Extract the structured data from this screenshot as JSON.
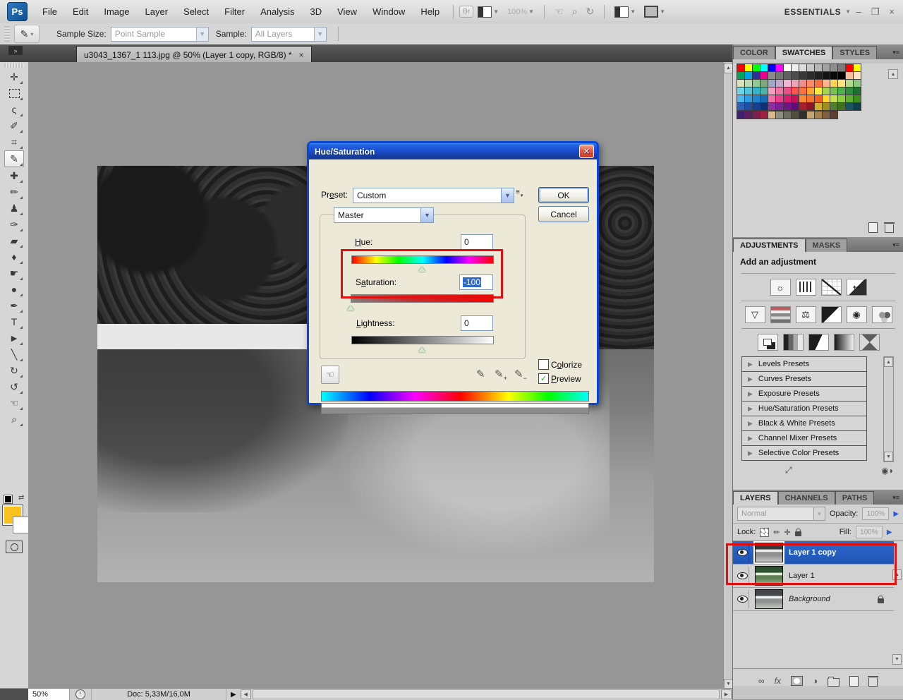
{
  "app": {
    "logo": "Ps",
    "menu": [
      "File",
      "Edit",
      "Image",
      "Layer",
      "Select",
      "Filter",
      "Analysis",
      "3D",
      "View",
      "Window",
      "Help"
    ],
    "br_label": "Br",
    "zoom_indicator": "100%",
    "workspace": "ESSENTIALS"
  },
  "icons": {
    "dropdown": "▼",
    "small_dd": "▾",
    "menu_lines": "≡",
    "min": "–",
    "restore": "❐",
    "win_close": "×",
    "up": "▲",
    "down": "▼",
    "left": "◀",
    "right": "▶",
    "flyout": "▶",
    "collapse": "»",
    "hand": "☜",
    "zoom_tool": "⌕",
    "rotate": "↻",
    "eyedropper": "✎",
    "check": "✓",
    "close": "✕",
    "plus": "+",
    "minus": "−",
    "sun": "☼",
    "vibrance": "▽",
    "scale": "⚖",
    "lens": "◉",
    "half_circle": "◑",
    "link": "∞",
    "fx": "fx",
    "expand": "⤢",
    "panel_eye": "◉◗"
  },
  "options_bar": {
    "sample_size_label": "Sample Size:",
    "sample_size_value": "Point Sample",
    "sample_label": "Sample:",
    "sample_value": "All Layers"
  },
  "document": {
    "tab_title": "u3043_1367_1 113.jpg @ 50% (Layer 1 copy, RGB/8) *",
    "status_zoom": "50%",
    "doc_size": "Doc: 5,33M/16,0M"
  },
  "tools": [
    {
      "name": "move-tool",
      "glyph": "✛"
    },
    {
      "name": "rectangular-marquee-tool",
      "cls": "g-marquee"
    },
    {
      "name": "lasso-tool",
      "glyph": "ς"
    },
    {
      "name": "quick-selection-tool",
      "glyph": "✐"
    },
    {
      "name": "crop-tool",
      "glyph": "⌗"
    },
    {
      "name": "eyedropper-tool",
      "glyph": "✎",
      "selected": true
    },
    {
      "name": "spot-healing-brush-tool",
      "glyph": "✚"
    },
    {
      "name": "brush-tool",
      "glyph": "✏"
    },
    {
      "name": "clone-stamp-tool",
      "glyph": "♟"
    },
    {
      "name": "history-brush-tool",
      "glyph": "✑"
    },
    {
      "name": "eraser-tool",
      "glyph": "▰"
    },
    {
      "name": "paint-bucket-tool",
      "glyph": "♦"
    },
    {
      "name": "smudge-tool",
      "glyph": "☛"
    },
    {
      "name": "burn-tool",
      "glyph": "●"
    },
    {
      "name": "pen-tool",
      "glyph": "✒"
    },
    {
      "name": "type-tool",
      "glyph": "T"
    },
    {
      "name": "path-selection-tool",
      "glyph": "►"
    },
    {
      "name": "line-tool",
      "glyph": "╲"
    },
    {
      "name": "3d-rotate-tool",
      "glyph": "↻"
    },
    {
      "name": "3d-orbit-tool",
      "glyph": "↺"
    },
    {
      "name": "hand-tool",
      "glyph": "☜"
    },
    {
      "name": "zoom-tool",
      "glyph": "⌕"
    }
  ],
  "toolbar_colors": {
    "foreground": "#F7C11E",
    "background": "#FFFFFF"
  },
  "dialog": {
    "title": "Hue/Saturation",
    "labels": {
      "preset": {
        "pre": "Pr",
        "key": "e",
        "post": "set:"
      },
      "hue": {
        "pre": "",
        "key": "H",
        "post": "ue:"
      },
      "saturation": {
        "pre": "S",
        "key": "a",
        "post": "turation:"
      },
      "lightness": {
        "pre": "",
        "key": "L",
        "post": "ightness:"
      },
      "colorize": {
        "pre": "C",
        "key": "o",
        "post": "lorize"
      },
      "preview": {
        "pre": "",
        "key": "P",
        "post": "review"
      }
    },
    "preset_value": "Custom",
    "channel_value": "Master",
    "hue_value": "0",
    "saturation_value": "-100",
    "lightness_value": "0",
    "ok": "OK",
    "cancel": "Cancel",
    "preview_checked": true,
    "colorize_checked": false
  },
  "panels": {
    "color_panel": {
      "tabs": [
        "COLOR",
        "SWATCHES",
        "STYLES"
      ],
      "active": 1
    },
    "swatches": {
      "colors": [
        "#FF0000",
        "#FFFF00",
        "#00FF00",
        "#00FFFF",
        "#0000FF",
        "#FF00FF",
        "#FFFFFF",
        "#EDEDED",
        "#DBDBDB",
        "#C8C8C8",
        "#B5B5B5",
        "#A1A1A1",
        "#8E8E8E",
        "#7A7A7A",
        "#FF0000",
        "#FFFF00",
        "#00A45A",
        "#00A0E4",
        "#2E3192",
        "#EC008C",
        "#8A8A8A",
        "#757575",
        "#616161",
        "#4D4D4D",
        "#383838",
        "#2B2B2B",
        "#1F1F1F",
        "#141414",
        "#0A0A0A",
        "#000000",
        "#F7BE9E",
        "#FCE2BF",
        "#D9E2B8",
        "#BBDCB3",
        "#93C993",
        "#7FA87F",
        "#9FA8C4",
        "#C3A8C9",
        "#F0B6D2",
        "#EFA3B7",
        "#F08C8C",
        "#FF8A66",
        "#FF6E43",
        "#FFB28C",
        "#FFD34F",
        "#FFE37F",
        "#B5D98A",
        "#8CC97F",
        "#6FD6E8",
        "#4FC6DC",
        "#2FB5CE",
        "#4FB3A5",
        "#F49FC0",
        "#F075A5",
        "#EC4F8A",
        "#FF5252",
        "#FF7043",
        "#FFA733",
        "#FFE93B",
        "#A6D64F",
        "#76C24F",
        "#4FAF4F",
        "#2F8F3F",
        "#1F6F2F",
        "#4FB6F0",
        "#2F9BE0",
        "#1F85D0",
        "#1670B8",
        "#F06FA5",
        "#EC3F8A",
        "#D81F6F",
        "#C21458",
        "#FB8C2F",
        "#F5742F",
        "#EF5F1F",
        "#FFD52F",
        "#C5E04F",
        "#8FCF3F",
        "#5FAF2F",
        "#3F8F1F",
        "#2F5FB5",
        "#1F4FA5",
        "#16408F",
        "#0F3075",
        "#8F2FA5",
        "#7F1F95",
        "#6F1585",
        "#5F0F75",
        "#A51F2F",
        "#8F1525",
        "#CFAF2F",
        "#9F8F1F",
        "#4F7F2F",
        "#3F6F1F",
        "#16555F",
        "#0F3F4F"
      ],
      "colors_tail": [
        "#3F1F6F",
        "#5F1F5F",
        "#7F1F4F",
        "#9F1F3F",
        "#D9B88C",
        "#8F8F7F",
        "#6F6F5F",
        "#4F4F3F",
        "#2F2F2F",
        "#C9A66F",
        "#A5804F",
        "#7F5F3F",
        "#5F3F2F"
      ]
    },
    "adjustments": {
      "tabs": [
        "ADJUSTMENTS",
        "MASKS"
      ],
      "active": 0,
      "heading": "Add an adjustment",
      "rows": [
        [
          {
            "id": "brightness-contrast",
            "g": "☼"
          },
          {
            "id": "levels"
          },
          {
            "id": "curves"
          },
          {
            "id": "exposure",
            "g": "+−"
          }
        ],
        [
          {
            "id": "vibrance",
            "g": "▽"
          },
          {
            "id": "hue-saturation",
            "cls": "t-huesat"
          },
          {
            "id": "color-balance",
            "g": "⚖"
          },
          {
            "id": "black-white",
            "cls": "t-bw"
          },
          {
            "id": "photo-filter",
            "g": "◉"
          },
          {
            "id": "channel-mixer",
            "cls": "t-chmixer"
          }
        ],
        [
          {
            "id": "invert",
            "cls": "t-invert"
          },
          {
            "id": "posterize",
            "cls": "t-posterize"
          },
          {
            "id": "threshold",
            "cls": "t-threshold"
          },
          {
            "id": "gradient-map",
            "cls": "t-gradmap"
          },
          {
            "id": "selective-color",
            "cls": "t-selcolor"
          }
        ]
      ],
      "presets": [
        "Levels Presets",
        "Curves Presets",
        "Exposure Presets",
        "Hue/Saturation Presets",
        "Black & White Presets",
        "Channel Mixer Presets",
        "Selective Color Presets"
      ]
    },
    "layers": {
      "tabs": [
        "LAYERS",
        "CHANNELS",
        "PATHS"
      ],
      "active": 0,
      "blend_mode": "Normal",
      "opacity_label": "Opacity:",
      "opacity_value": "100%",
      "lock_label": "Lock:",
      "fill_label": "Fill:",
      "fill_value": "100%",
      "items": [
        {
          "name": "Layer 1 copy",
          "selected": true,
          "thumb": "th-grey"
        },
        {
          "name": "Layer 1",
          "thumb": "th-color"
        },
        {
          "name": "Background",
          "italic": true,
          "locked": true,
          "thumb": "th-muted"
        }
      ]
    }
  }
}
